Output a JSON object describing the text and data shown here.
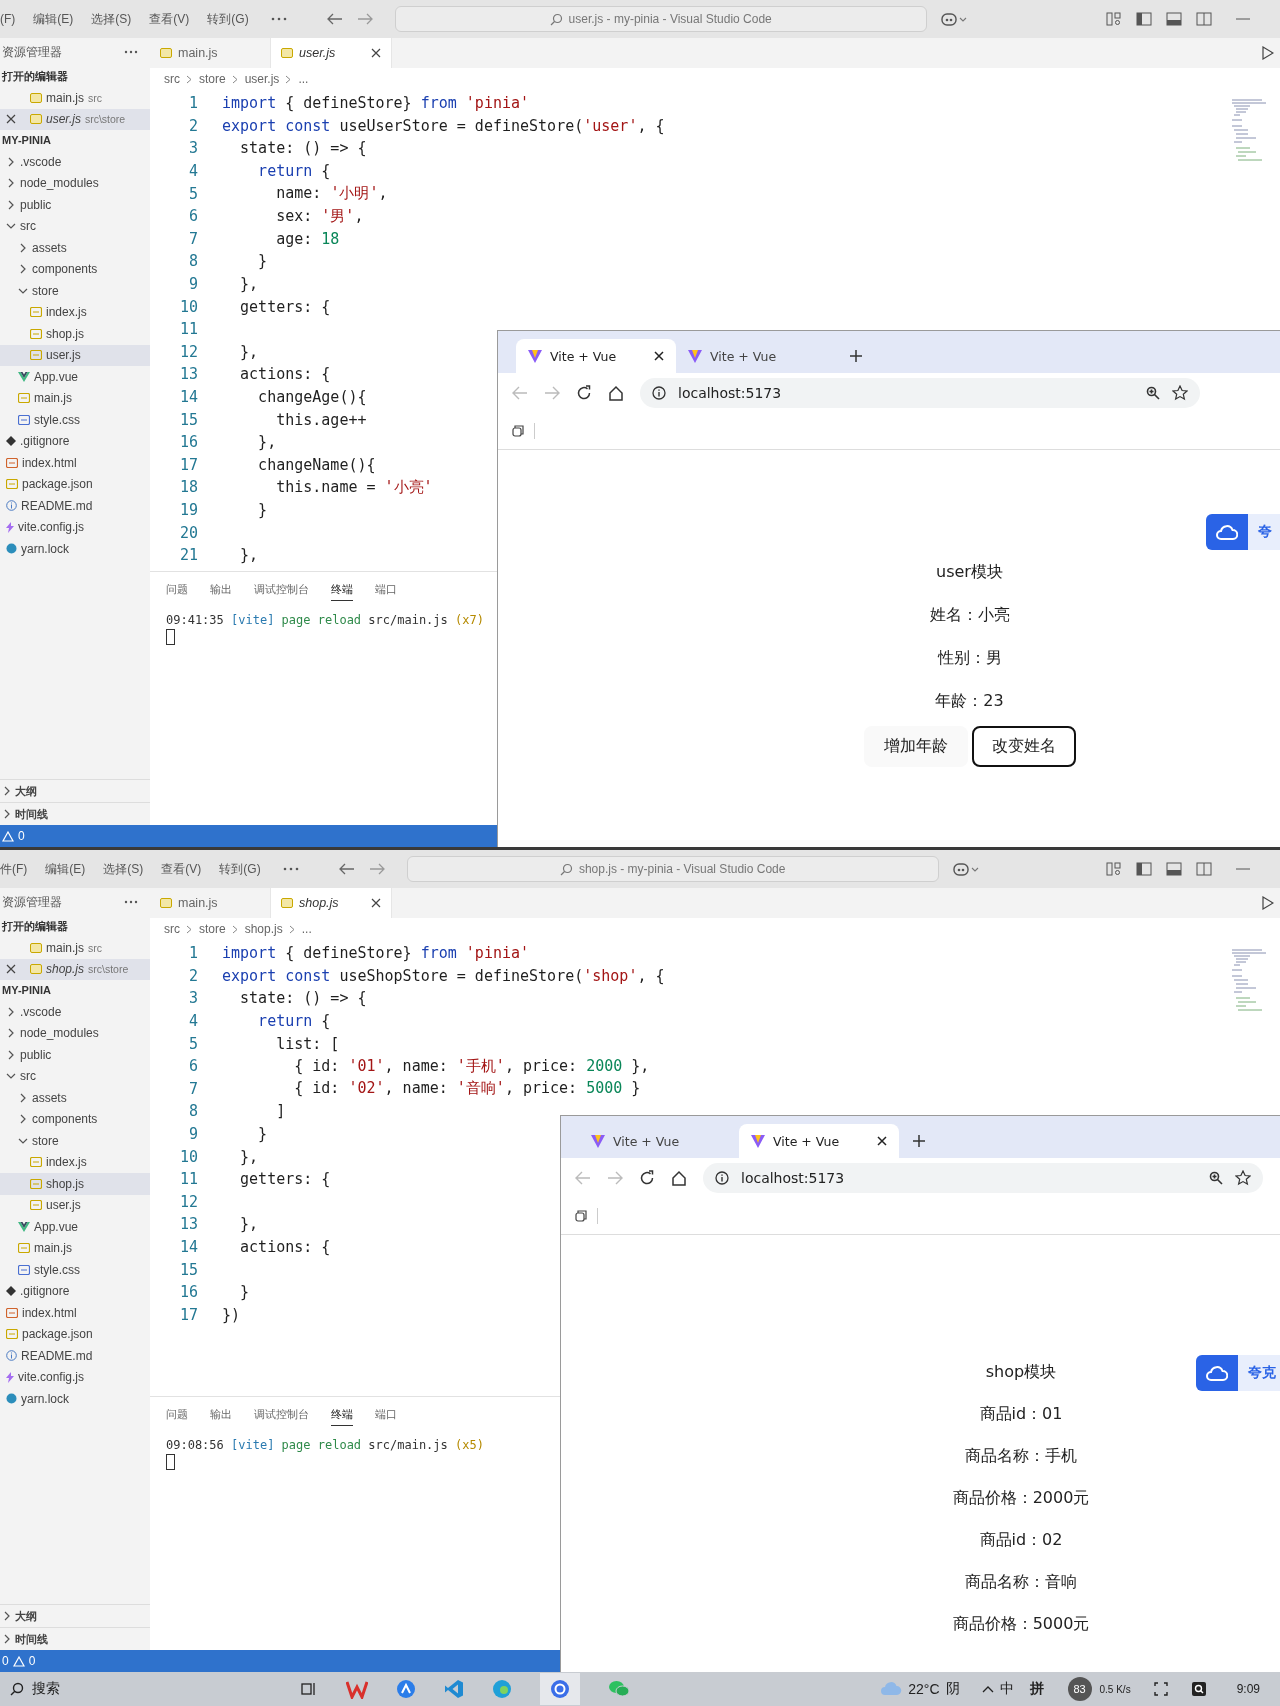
{
  "windows": [
    {
      "menu": [
        "(F)",
        "编辑(E)",
        "选择(S)",
        "查看(V)",
        "转到(G)"
      ],
      "title": "user.js - my-pinia - Visual Studio Code",
      "sidebar": {
        "header": "资源管理器",
        "open_editors_title": "打开的编辑器",
        "open_editors": [
          {
            "file": "main.js",
            "dir": "src",
            "selected": false
          },
          {
            "file": "user.js",
            "dir": "src\\store",
            "selected": true
          }
        ],
        "project": "MY-PINIA",
        "tree": [
          {
            "label": ".vscode",
            "kind": "folder",
            "expanded": false,
            "selected": false
          },
          {
            "label": "node_modules",
            "kind": "folder",
            "expanded": false,
            "selected": false
          },
          {
            "label": "public",
            "kind": "folder",
            "expanded": false,
            "selected": false
          },
          {
            "label": "src",
            "kind": "folder",
            "expanded": true,
            "selected": false,
            "children": [
              {
                "label": "assets",
                "kind": "folder",
                "expanded": false,
                "selected": false
              },
              {
                "label": "components",
                "kind": "folder",
                "expanded": false,
                "selected": false
              },
              {
                "label": "store",
                "kind": "folder",
                "expanded": true,
                "selected": false,
                "children": [
                  {
                    "label": "index.js",
                    "kind": "js",
                    "selected": false
                  },
                  {
                    "label": "shop.js",
                    "kind": "js",
                    "selected": false
                  },
                  {
                    "label": "user.js",
                    "kind": "js",
                    "selected": true
                  }
                ]
              },
              {
                "label": "App.vue",
                "kind": "vue",
                "selected": false
              },
              {
                "label": "main.js",
                "kind": "js",
                "selected": false
              },
              {
                "label": "style.css",
                "kind": "css",
                "selected": false
              }
            ]
          },
          {
            "label": ".gitignore",
            "kind": "git",
            "selected": false
          },
          {
            "label": "index.html",
            "kind": "html",
            "selected": false
          },
          {
            "label": "package.json",
            "kind": "json",
            "selected": false
          },
          {
            "label": "README.md",
            "kind": "info",
            "selected": false
          },
          {
            "label": "vite.config.js",
            "kind": "vite",
            "selected": false
          },
          {
            "label": "yarn.lock",
            "kind": "yarn",
            "selected": false
          }
        ],
        "outline": "大纲",
        "timeline": "时间线"
      },
      "tabs": [
        {
          "label": "main.js",
          "selected": false
        },
        {
          "label": "user.js",
          "selected": true
        }
      ],
      "breadcrumb": [
        "src",
        "store",
        "user.js",
        "..."
      ],
      "code": [
        {
          "number": "1",
          "tokens": [
            {
              "text": "import",
              "kind": "kw"
            },
            {
              "text": " { defineStore} ",
              "kind": "txt"
            },
            {
              "text": "from",
              "kind": "kw"
            },
            {
              "text": " 'pinia'",
              "kind": "str"
            }
          ]
        },
        {
          "number": "2",
          "tokens": [
            {
              "text": "export const",
              "kind": "kw"
            },
            {
              "text": " useUserStore = defineStore(",
              "kind": "txt"
            },
            {
              "text": "'user'",
              "kind": "str"
            },
            {
              "text": ", {",
              "kind": "txt"
            }
          ]
        },
        {
          "number": "3",
          "tokens": [
            {
              "text": "  state: () => {",
              "kind": "txt"
            }
          ]
        },
        {
          "number": "4",
          "tokens": [
            {
              "text": "    return",
              "kind": "kw"
            },
            {
              "text": " {",
              "kind": "txt"
            }
          ]
        },
        {
          "number": "5",
          "tokens": [
            {
              "text": "      name: ",
              "kind": "txt"
            },
            {
              "text": "'小明'",
              "kind": "str"
            },
            {
              "text": ",",
              "kind": "txt"
            }
          ]
        },
        {
          "number": "6",
          "tokens": [
            {
              "text": "      sex: ",
              "kind": "txt"
            },
            {
              "text": "'男'",
              "kind": "str"
            },
            {
              "text": ",",
              "kind": "txt"
            }
          ]
        },
        {
          "number": "7",
          "tokens": [
            {
              "text": "      age: ",
              "kind": "txt"
            },
            {
              "text": "18",
              "kind": "num"
            }
          ]
        },
        {
          "number": "8",
          "tokens": [
            {
              "text": "    }",
              "kind": "txt"
            }
          ]
        },
        {
          "number": "9",
          "tokens": [
            {
              "text": "  },",
              "kind": "txt"
            }
          ]
        },
        {
          "number": "10",
          "tokens": [
            {
              "text": "  getters: {",
              "kind": "txt"
            }
          ]
        },
        {
          "number": "11"
        },
        {
          "number": "12",
          "tokens": [
            {
              "text": "  },",
              "kind": "txt"
            }
          ]
        },
        {
          "number": "13",
          "tokens": [
            {
              "text": "  actions: {",
              "kind": "txt"
            }
          ]
        },
        {
          "number": "14",
          "tokens": [
            {
              "text": "    changeAge(){",
              "kind": "txt"
            }
          ]
        },
        {
          "number": "15",
          "tokens": [
            {
              "text": "      this.age++",
              "kind": "txt"
            }
          ]
        },
        {
          "number": "16",
          "tokens": [
            {
              "text": "    },",
              "kind": "txt"
            }
          ]
        },
        {
          "number": "17",
          "tokens": [
            {
              "text": "    changeName(){",
              "kind": "txt"
            }
          ]
        },
        {
          "number": "18",
          "tokens": [
            {
              "text": "      this.name = ",
              "kind": "txt"
            },
            {
              "text": "'小亮'",
              "kind": "str"
            }
          ]
        },
        {
          "number": "19",
          "tokens": [
            {
              "text": "    }",
              "kind": "txt"
            }
          ]
        },
        {
          "number": "20"
        },
        {
          "number": "21",
          "tokens": [
            {
              "text": "  },",
              "kind": "txt"
            }
          ]
        }
      ],
      "panel_tabs": [
        {
          "label": "问题",
          "selected": false
        },
        {
          "label": "输出",
          "selected": false
        },
        {
          "label": "调试控制台",
          "selected": false
        },
        {
          "label": "终端",
          "selected": true
        },
        {
          "label": "端口",
          "selected": false
        }
      ],
      "terminal": [
        {
          "text": "09:41:35 ",
          "kind": "time"
        },
        {
          "text": "[vite]",
          "kind": "tag"
        },
        {
          "text": " page reload ",
          "kind": "message"
        },
        {
          "text": "src/main.js",
          "kind": "path"
        },
        {
          "text": " (x7)",
          "kind": "count"
        }
      ],
      "status": {
        "warnings": "0"
      },
      "browser": {
        "tabs": [
          {
            "title": "Vite + Vue",
            "selected": true
          },
          {
            "title": "Vite + Vue",
            "selected": false
          }
        ],
        "url": "localhost:5173",
        "widget": "夸",
        "page": {
          "heading": "user模块",
          "lines": [
            "姓名：小亮",
            "性别：男",
            "年龄：23"
          ],
          "buttons": [
            {
              "label": "增加年龄",
              "focused": false
            },
            {
              "label": "改变姓名",
              "focused": true
            }
          ]
        }
      }
    },
    {
      "menu": [
        "件(F)",
        "编辑(E)",
        "选择(S)",
        "查看(V)",
        "转到(G)"
      ],
      "title": "shop.js - my-pinia - Visual Studio Code",
      "sidebar": {
        "header": "资源管理器",
        "open_editors_title": "打开的编辑器",
        "open_editors": [
          {
            "file": "main.js",
            "dir": "src",
            "selected": false
          },
          {
            "file": "shop.js",
            "dir": "src\\store",
            "selected": true
          }
        ],
        "project": "MY-PINIA",
        "tree": [
          {
            "label": ".vscode",
            "kind": "folder",
            "expanded": false,
            "selected": false
          },
          {
            "label": "node_modules",
            "kind": "folder",
            "expanded": false,
            "selected": false
          },
          {
            "label": "public",
            "kind": "folder",
            "expanded": false,
            "selected": false
          },
          {
            "label": "src",
            "kind": "folder",
            "expanded": true,
            "selected": false,
            "children": [
              {
                "label": "assets",
                "kind": "folder",
                "expanded": false,
                "selected": false
              },
              {
                "label": "components",
                "kind": "folder",
                "expanded": false,
                "selected": false
              },
              {
                "label": "store",
                "kind": "folder",
                "expanded": true,
                "selected": false,
                "children": [
                  {
                    "label": "index.js",
                    "kind": "js",
                    "selected": false
                  },
                  {
                    "label": "shop.js",
                    "kind": "js",
                    "selected": true
                  },
                  {
                    "label": "user.js",
                    "kind": "js",
                    "selected": false
                  }
                ]
              },
              {
                "label": "App.vue",
                "kind": "vue",
                "selected": false
              },
              {
                "label": "main.js",
                "kind": "js",
                "selected": false
              },
              {
                "label": "style.css",
                "kind": "css",
                "selected": false
              }
            ]
          },
          {
            "label": ".gitignore",
            "kind": "git",
            "selected": false
          },
          {
            "label": "index.html",
            "kind": "html",
            "selected": false
          },
          {
            "label": "package.json",
            "kind": "json",
            "selected": false
          },
          {
            "label": "README.md",
            "kind": "info",
            "selected": false
          },
          {
            "label": "vite.config.js",
            "kind": "vite",
            "selected": false
          },
          {
            "label": "yarn.lock",
            "kind": "yarn",
            "selected": false
          }
        ],
        "outline": "大纲",
        "timeline": "时间线"
      },
      "tabs": [
        {
          "label": "main.js",
          "selected": false
        },
        {
          "label": "shop.js",
          "selected": true
        }
      ],
      "breadcrumb": [
        "src",
        "store",
        "shop.js",
        "..."
      ],
      "code": [
        {
          "number": "1",
          "tokens": [
            {
              "text": "import",
              "kind": "kw"
            },
            {
              "text": " { defineStore} ",
              "kind": "txt"
            },
            {
              "text": "from",
              "kind": "kw"
            },
            {
              "text": " 'pinia'",
              "kind": "str"
            }
          ]
        },
        {
          "number": "2",
          "tokens": [
            {
              "text": "export const",
              "kind": "kw"
            },
            {
              "text": " useShopStore = defineStore(",
              "kind": "txt"
            },
            {
              "text": "'shop'",
              "kind": "str"
            },
            {
              "text": ", {",
              "kind": "txt"
            }
          ]
        },
        {
          "number": "3",
          "tokens": [
            {
              "text": "  state: () => {",
              "kind": "txt"
            }
          ]
        },
        {
          "number": "4",
          "tokens": [
            {
              "text": "    return",
              "kind": "kw"
            },
            {
              "text": " {",
              "kind": "txt"
            }
          ]
        },
        {
          "number": "5",
          "tokens": [
            {
              "text": "      list: [",
              "kind": "txt"
            }
          ]
        },
        {
          "number": "6",
          "tokens": [
            {
              "text": "        { id: ",
              "kind": "txt"
            },
            {
              "text": "'01'",
              "kind": "str"
            },
            {
              "text": ", name: ",
              "kind": "txt"
            },
            {
              "text": "'手机'",
              "kind": "str"
            },
            {
              "text": ", price: ",
              "kind": "txt"
            },
            {
              "text": "2000",
              "kind": "num"
            },
            {
              "text": " },",
              "kind": "txt"
            }
          ]
        },
        {
          "number": "7",
          "tokens": [
            {
              "text": "        { id: ",
              "kind": "txt"
            },
            {
              "text": "'02'",
              "kind": "str"
            },
            {
              "text": ", name: ",
              "kind": "txt"
            },
            {
              "text": "'音响'",
              "kind": "str"
            },
            {
              "text": ", price: ",
              "kind": "txt"
            },
            {
              "text": "5000",
              "kind": "num"
            },
            {
              "text": " }",
              "kind": "txt"
            }
          ]
        },
        {
          "number": "8",
          "tokens": [
            {
              "text": "      ]",
              "kind": "txt"
            }
          ]
        },
        {
          "number": "9",
          "tokens": [
            {
              "text": "    }",
              "kind": "txt"
            }
          ]
        },
        {
          "number": "10",
          "tokens": [
            {
              "text": "  },",
              "kind": "txt"
            }
          ]
        },
        {
          "number": "11",
          "tokens": [
            {
              "text": "  getters: {",
              "kind": "txt"
            }
          ]
        },
        {
          "number": "12"
        },
        {
          "number": "13",
          "tokens": [
            {
              "text": "  },",
              "kind": "txt"
            }
          ]
        },
        {
          "number": "14",
          "tokens": [
            {
              "text": "  actions: {",
              "kind": "txt"
            }
          ]
        },
        {
          "number": "15"
        },
        {
          "number": "16",
          "tokens": [
            {
              "text": "  }",
              "kind": "txt"
            }
          ]
        },
        {
          "number": "17",
          "tokens": [
            {
              "text": "})",
              "kind": "txt"
            }
          ]
        }
      ],
      "panel_tabs": [
        {
          "label": "问题",
          "selected": false
        },
        {
          "label": "输出",
          "selected": false
        },
        {
          "label": "调试控制台",
          "selected": false
        },
        {
          "label": "终端",
          "selected": true
        },
        {
          "label": "端口",
          "selected": false
        }
      ],
      "terminal": [
        {
          "text": "09:08:56 ",
          "kind": "time"
        },
        {
          "text": "[vite]",
          "kind": "tag"
        },
        {
          "text": " page reload ",
          "kind": "message"
        },
        {
          "text": "src/main.js",
          "kind": "path"
        },
        {
          "text": " (x5)",
          "kind": "count"
        }
      ],
      "status": {
        "errors": "0",
        "warnings": "0"
      },
      "browser": {
        "tabs": [
          {
            "title": "Vite + Vue",
            "selected": false
          },
          {
            "title": "Vite + Vue",
            "selected": true
          }
        ],
        "url": "localhost:5173",
        "widget": "夸克",
        "page": {
          "heading": "shop模块",
          "lines": [
            "商品id：01",
            "商品名称：手机",
            "商品价格：2000元",
            "商品id：02",
            "商品名称：音响",
            "商品价格：5000元"
          ]
        }
      }
    }
  ],
  "taskbar": {
    "search": "搜索",
    "temperature": "22°C",
    "condition": "阴",
    "ime_mode": "中",
    "ime": "拼",
    "badge": "83",
    "net_speed": "0.5 K/s",
    "time": "9:09"
  }
}
